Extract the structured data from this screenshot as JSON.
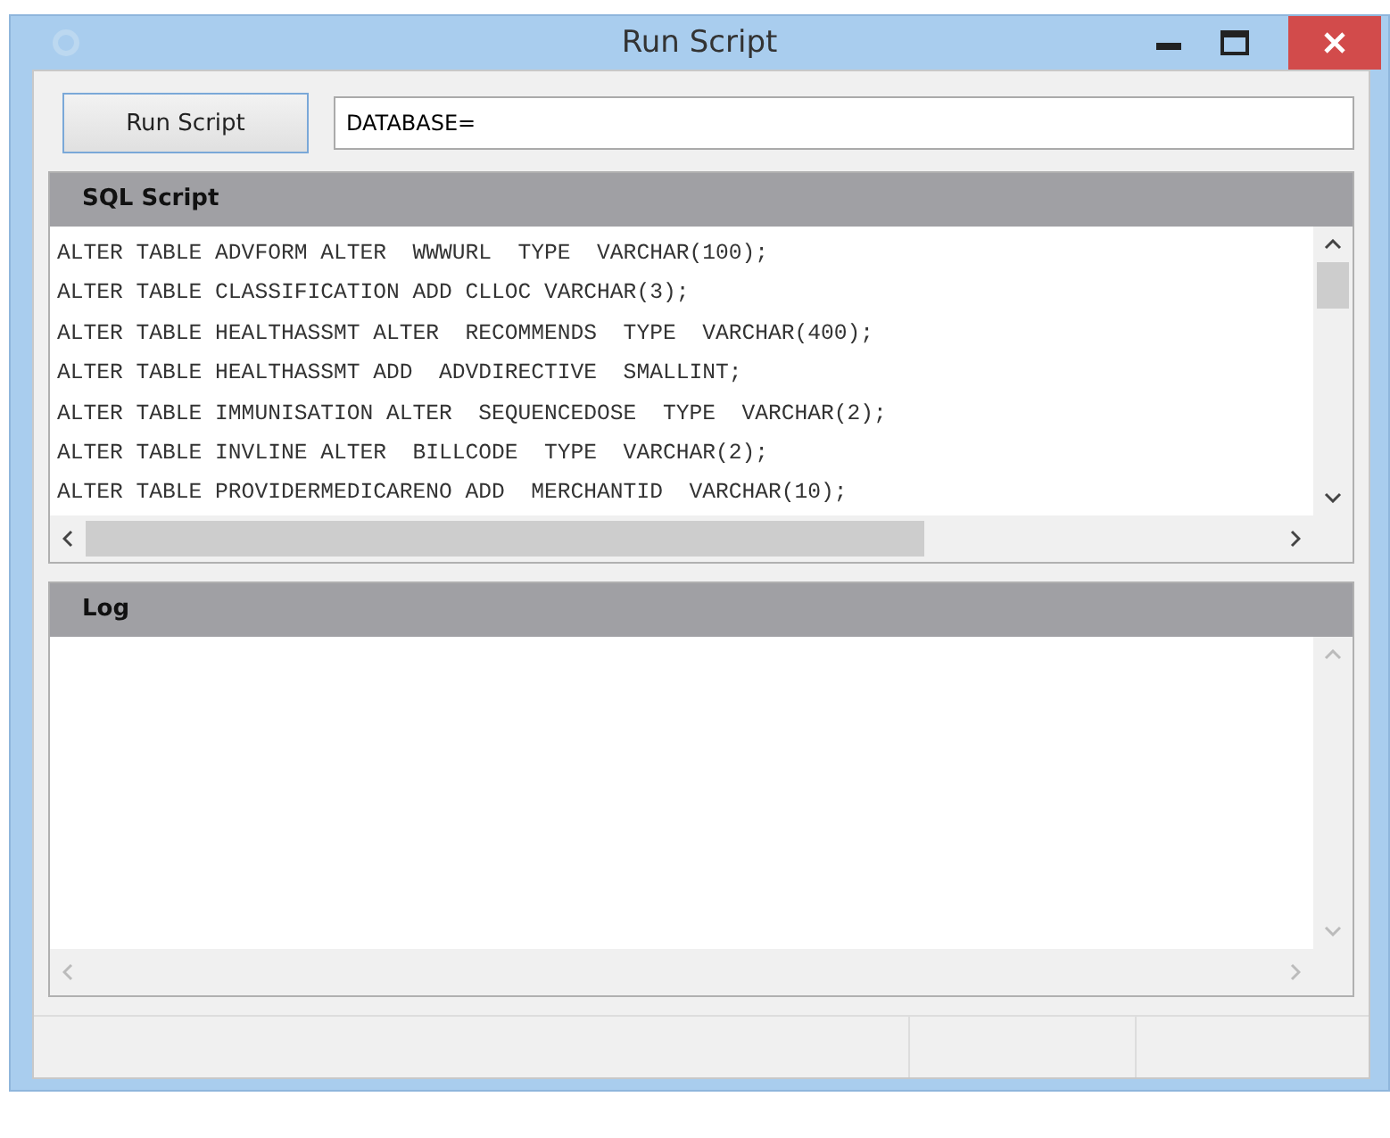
{
  "window": {
    "title": "Run Script"
  },
  "toolbar": {
    "button": "Run Script",
    "connection_field": {
      "value": "DATABASE="
    }
  },
  "sql_panel": {
    "title": "SQL Script",
    "lines": [
      "ALTER TABLE ADVFORM ALTER  WWWURL  TYPE  VARCHAR(100);",
      "ALTER TABLE CLASSIFICATION ADD CLLOC VARCHAR(3);",
      "ALTER TABLE HEALTHASSMT ALTER  RECOMMENDS  TYPE  VARCHAR(400);",
      "ALTER TABLE HEALTHASSMT ADD  ADVDIRECTIVE  SMALLINT;",
      "ALTER TABLE IMMUNISATION ALTER  SEQUENCEDOSE  TYPE  VARCHAR(2);",
      "ALTER TABLE INVLINE ALTER  BILLCODE  TYPE  VARCHAR(2);",
      "ALTER TABLE PROVIDERMEDICARENO ADD  MERCHANTID  VARCHAR(10);"
    ]
  },
  "log_panel": {
    "title": "Log"
  }
}
